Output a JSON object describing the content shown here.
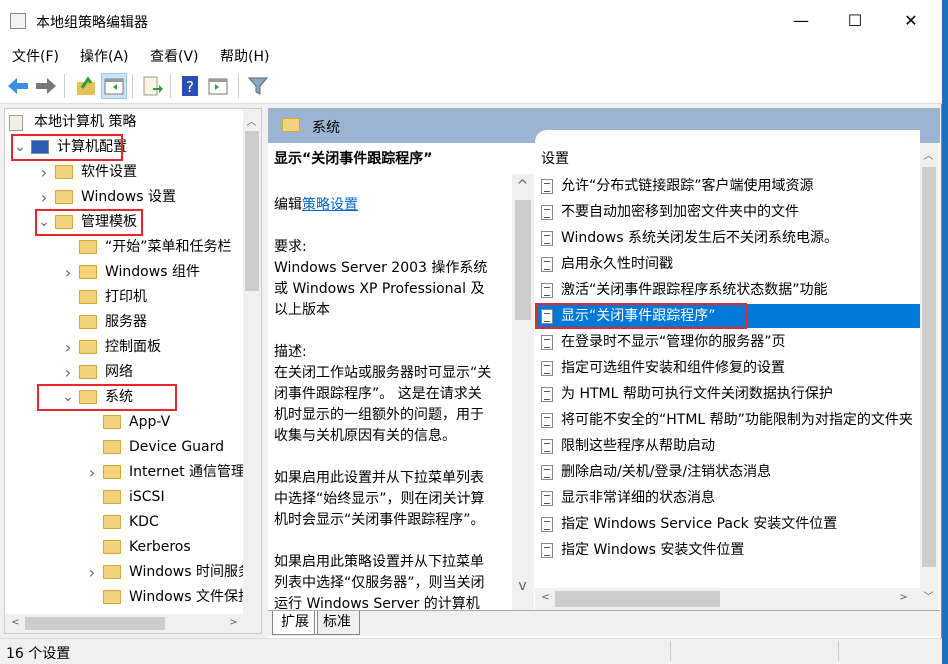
{
  "window": {
    "title": "本地组策略编辑器",
    "minimize": "—",
    "maximize": "☐",
    "close": "✕"
  },
  "menu": [
    "文件(F)",
    "操作(A)",
    "查看(V)",
    "帮助(H)"
  ],
  "toolbar": [
    "back-icon",
    "forward-icon",
    "up-folder-icon",
    "show-hide-tree-icon",
    "export-list-icon",
    "help-icon",
    "show-hide-action-pane-icon",
    "filter-icon"
  ],
  "tree": [
    {
      "label": "本地计算机 策略",
      "level": 0,
      "exp": "none",
      "icon": "policy-scroll-icon"
    },
    {
      "label": "计算机配置",
      "level": 1,
      "exp": "open",
      "icon": "computer-icon",
      "highlight": true
    },
    {
      "label": "软件设置",
      "level": 2,
      "exp": "closed"
    },
    {
      "label": "Windows 设置",
      "level": 2,
      "exp": "closed"
    },
    {
      "label": "管理模板",
      "level": 2,
      "exp": "open",
      "highlight": true
    },
    {
      "label": "“开始”菜单和任务栏",
      "level": 3,
      "exp": "none"
    },
    {
      "label": "Windows 组件",
      "level": 3,
      "exp": "closed"
    },
    {
      "label": "打印机",
      "level": 3,
      "exp": "none"
    },
    {
      "label": "服务器",
      "level": 3,
      "exp": "none"
    },
    {
      "label": "控制面板",
      "level": 3,
      "exp": "closed"
    },
    {
      "label": "网络",
      "level": 3,
      "exp": "closed"
    },
    {
      "label": "系统",
      "level": 3,
      "exp": "open",
      "highlight": true
    },
    {
      "label": "App-V",
      "level": 4,
      "exp": "none"
    },
    {
      "label": "Device Guard",
      "level": 4,
      "exp": "none"
    },
    {
      "label": "Internet 通信管理",
      "level": 4,
      "exp": "closed"
    },
    {
      "label": "iSCSI",
      "level": 4,
      "exp": "none"
    },
    {
      "label": "KDC",
      "level": 4,
      "exp": "none"
    },
    {
      "label": "Kerberos",
      "level": 4,
      "exp": "none"
    },
    {
      "label": "Windows 时间服务",
      "level": 4,
      "exp": "closed"
    },
    {
      "label": "Windows 文件保护",
      "level": 4,
      "exp": "none"
    }
  ],
  "header": {
    "title": "系统"
  },
  "description": {
    "title": "显示“关闭事件跟踪程序”",
    "edit_prefix": "编辑",
    "edit_link": "策略设置",
    "lines": [
      {
        "t": "要求:",
        "y": 0
      },
      {
        "t": "Windows Server 2003 操作系统",
        "y": 1
      },
      {
        "t": "或 Windows XP Professional 及",
        "y": 2
      },
      {
        "t": "以上版本",
        "y": 3
      },
      {
        "t": "描述:",
        "y": 5
      },
      {
        "t": "在关闭工作站或服务器时可显示“关",
        "y": 6
      },
      {
        "t": "闭事件跟踪程序”。 这是在请求关",
        "y": 7
      },
      {
        "t": "机时显示的一组额外的问题，用于",
        "y": 8
      },
      {
        "t": "收集与关机原因有关的信息。",
        "y": 9
      },
      {
        "t": "如果启用此设置并从下拉菜单列表",
        "y": 11
      },
      {
        "t": "中选择“始终显示”，则在闭关计算",
        "y": 12
      },
      {
        "t": "机时会显示“关闭事件跟踪程序”。",
        "y": 13
      },
      {
        "t": "如果启用此策略设置并从下拉菜单",
        "y": 15
      },
      {
        "t": "列表中选择“仅服务器”，则当关闭",
        "y": 16
      },
      {
        "t": "运行 Windows Server 的计算机",
        "y": 17
      }
    ]
  },
  "list": {
    "header": "设置",
    "items": [
      "允许“分布式链接跟踪”客户端使用域资源",
      "不要自动加密移到加密文件夹中的文件",
      "Windows 系统关闭发生后不关闭系统电源。",
      "启用永久性时间戳",
      "激活“关闭事件跟踪程序系统状态数据”功能",
      "显示“关闭事件跟踪程序”",
      "在登录时不显示“管理你的服务器”页",
      "指定可选组件安装和组件修复的设置",
      "为 HTML 帮助可执行文件关闭数据执行保护",
      "将可能不安全的“HTML 帮助”功能限制为对指定的文件夹",
      "限制这些程序从帮助启动",
      "删除启动/关机/登录/注销状态消息",
      "显示非常详细的状态消息",
      "指定 Windows Service Pack 安装文件位置",
      "指定 Windows 安装文件位置"
    ],
    "selected_index": 5
  },
  "tabs": [
    "扩展",
    "标准"
  ],
  "active_tab": 0,
  "status": "16 个设置",
  "colors": {
    "selection": "#0078d7",
    "header_band": "#9cb4d2",
    "annotation_box": "#e8262a",
    "link": "#0066cc"
  }
}
